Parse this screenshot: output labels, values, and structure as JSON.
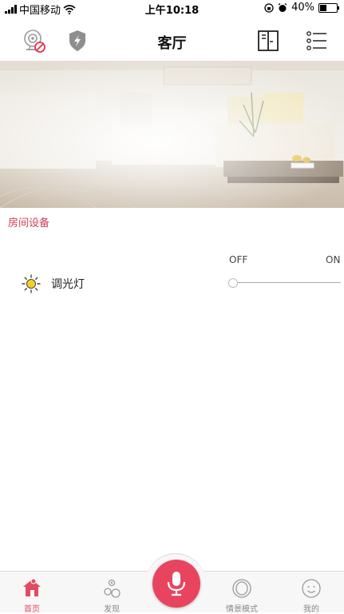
{
  "status_bar": {
    "carrier": "中国移动",
    "time": "上午10:18",
    "battery": "40%",
    "battery_level": 0.4
  },
  "header": {
    "title": "客厅"
  },
  "section": {
    "title": "房间设备"
  },
  "device": {
    "name": "调光灯",
    "off_label": "OFF",
    "on_label": "ON",
    "level": 0.0
  },
  "tabs": [
    {
      "label": "首页",
      "icon": "home-icon",
      "active": true
    },
    {
      "label": "发现",
      "icon": "discover-icon",
      "active": false
    },
    {
      "label": "情景模式",
      "icon": "scene-icon",
      "active": false
    },
    {
      "label": "我的",
      "icon": "profile-icon",
      "active": false
    }
  ],
  "colors": {
    "accent": "#e9445f",
    "section": "#d63a55",
    "tab_inactive": "#8a8a8a",
    "brand_red": "#e44a5f"
  }
}
